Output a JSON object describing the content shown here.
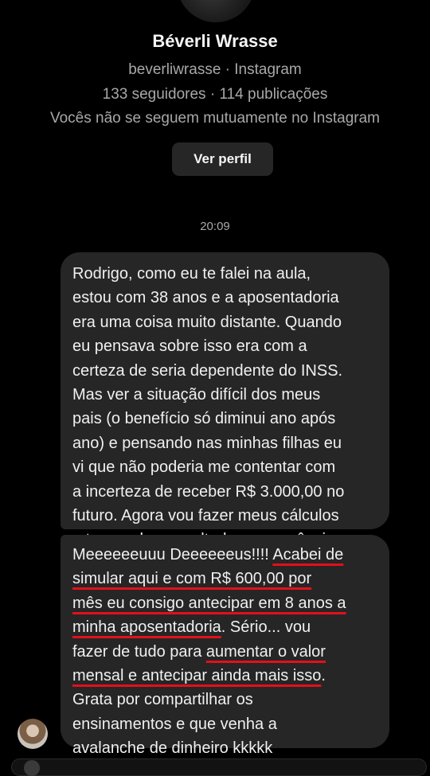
{
  "profile": {
    "name": "Béverli Wrasse",
    "handle_line": "beverliwrasse · Instagram",
    "stats_line": "133 seguidores · 114 publicações",
    "mutual_line": "Vocês não se seguem mutuamente no Instagram",
    "view_profile_button": "Ver perfil"
  },
  "thread": {
    "timestamp": "20:09",
    "messages": [
      {
        "lines": [
          "Rodrigo, como eu te falei na aula,",
          "estou com 38 anos e a aposentadoria",
          "era uma coisa muito distante. Quando",
          "eu pensava sobre isso era com a",
          "certeza de seria dependente do INSS.",
          "Mas ver a situação difícil dos meus",
          "pais (o benefício só diminui ano após",
          "ano) e pensando nas minhas filhas eu",
          "vi que não poderia me contentar com",
          "a incerteza de receber R$ 3.000,00 no",
          "futuro. Agora vou fazer meus cálculos",
          "e te mando o resultado na sequência."
        ]
      },
      {
        "l1_plain": "Meeeeeeuuu Deeeeeeus!!!! ",
        "l1_ul": "Acabei de",
        "l2_ul": "simular aqui e com R$ 600,00 por",
        "l3_ul": "mês eu consigo antecipar em 8 anos a",
        "l4_ul": "minha aposentadoria",
        "l4_plain": ". Sério... vou",
        "l5_plain": "fazer de tudo para ",
        "l5_ul": "aumentar o valor",
        "l6_ul": "mensal e antecipar ainda mais isso",
        "l6_plain": ".",
        "l7": "Grata por compartilhar os",
        "l8": "ensinamentos e que venha a",
        "l9": "avalanche de dinheiro kkkkk"
      }
    ]
  },
  "colors": {
    "background": "#000000",
    "bubble": "#262626",
    "secondary_text": "#a8a8a8",
    "annotation_underline": "#e3101b"
  }
}
